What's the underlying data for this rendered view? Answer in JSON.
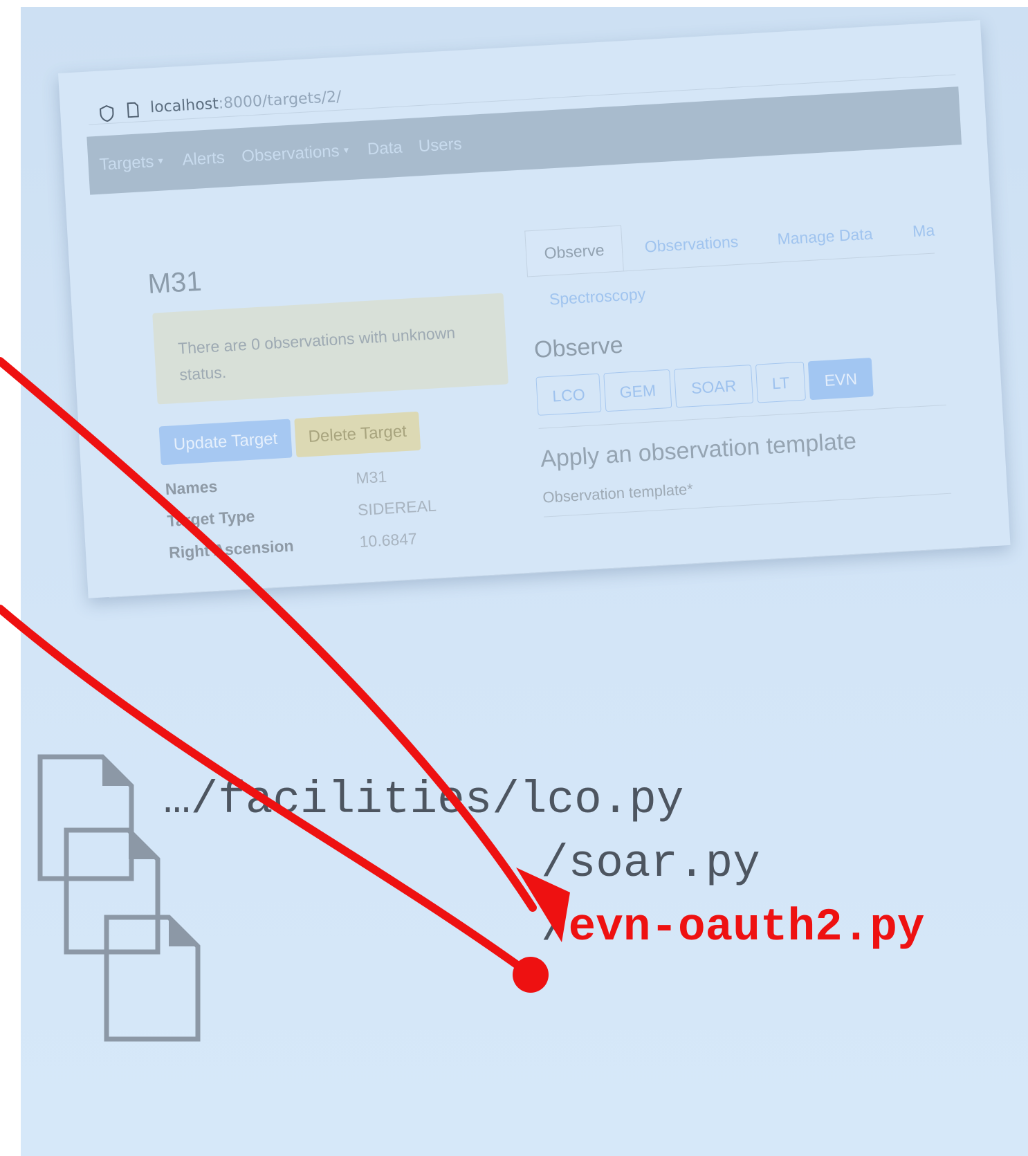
{
  "browser": {
    "url_host": "localhost",
    "url_path": ":8000/targets/2/",
    "nav_items": [
      "Targets",
      "Alerts",
      "Observations",
      "Data",
      "Users"
    ]
  },
  "target": {
    "title": "M31",
    "alert_line1": "There are 0 observations with unknown",
    "alert_line2": "status.",
    "update_button": "Update Target",
    "delete_button": "Delete Target",
    "details": [
      {
        "label": "Names",
        "value": "M31"
      },
      {
        "label": "Target Type",
        "value": "SIDEREAL"
      },
      {
        "label": "Right Ascension",
        "value": "10.6847"
      }
    ]
  },
  "tabs": {
    "active": "Observe",
    "items": [
      "Observations",
      "Manage Data",
      "Ma",
      "Spectroscopy"
    ]
  },
  "observe": {
    "heading": "Observe",
    "facilities": [
      "LCO",
      "GEM",
      "SOAR",
      "LT",
      "EVN"
    ],
    "active_facility": "EVN",
    "template_heading": "Apply an observation template",
    "template_label": "Observation template*"
  },
  "files": {
    "line1": "…/facilities/lco.py",
    "line2": "/soar.py",
    "line3_prefix": "/",
    "line3_highlight": "evn-oauth2.py"
  },
  "colors": {
    "arrow": "#ee1111",
    "background": "#d3e5f7",
    "highlight_text": "#ee1111"
  }
}
